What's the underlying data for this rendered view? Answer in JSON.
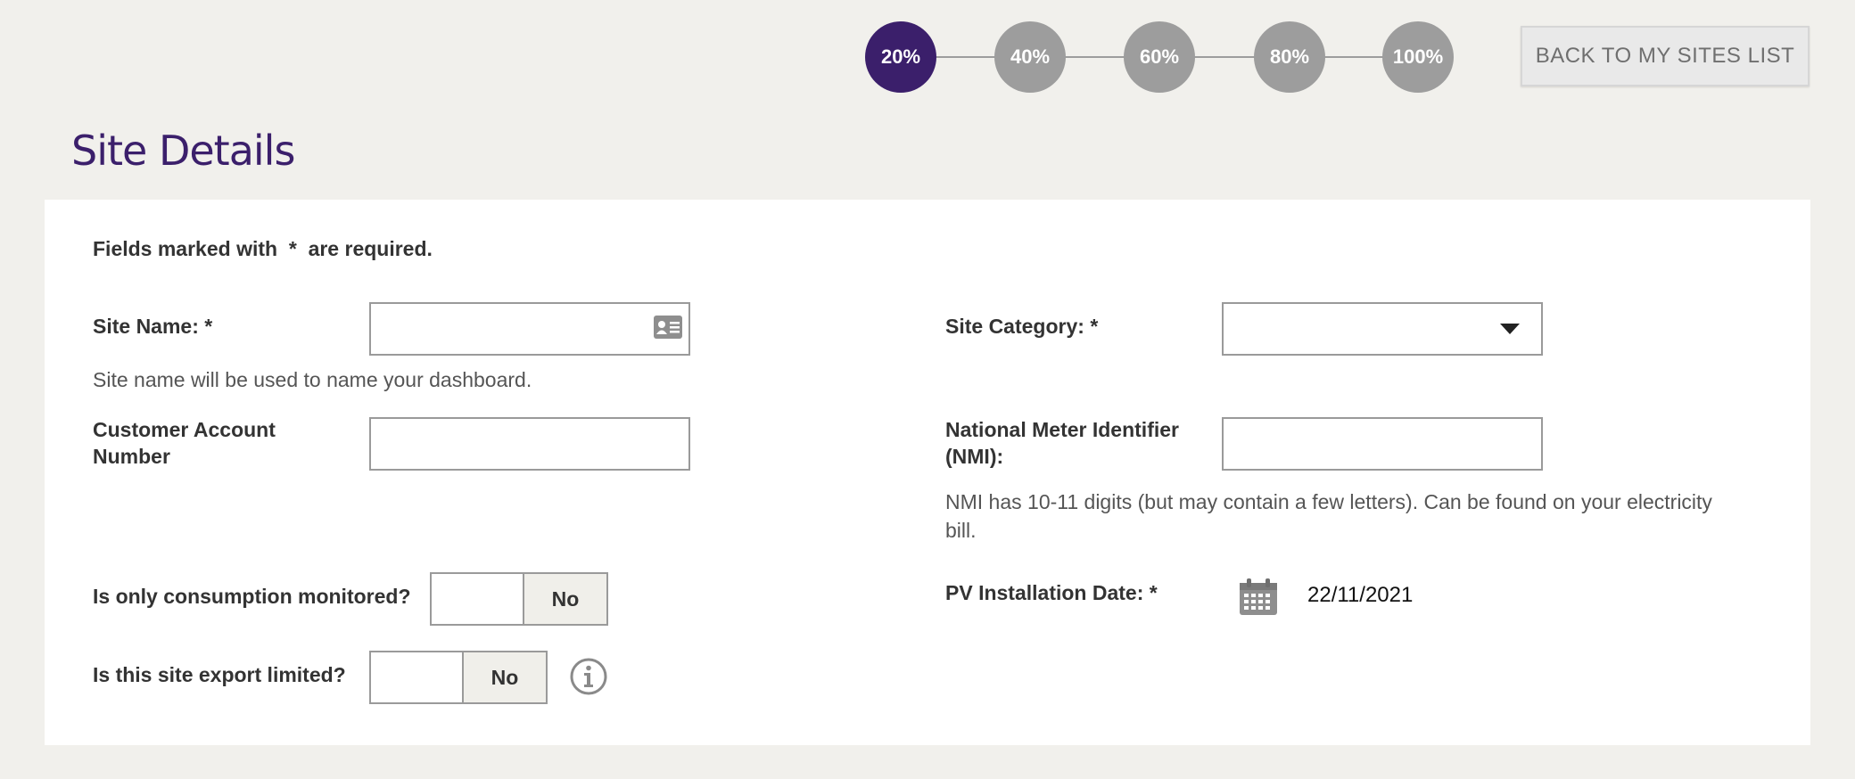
{
  "progress": {
    "steps": [
      "20%",
      "40%",
      "60%",
      "80%",
      "100%"
    ],
    "active_step": "20%"
  },
  "header": {
    "back_button_label": "BACK TO MY SITES LIST",
    "page_title": "Site Details"
  },
  "form": {
    "required_note": "Fields marked with  *  are required.",
    "site_name": {
      "label": "Site Name: *",
      "value": "",
      "hint": "Site name will be used to name your dashboard.",
      "icon": "contact-card-icon"
    },
    "site_category": {
      "label": "Site Category: *",
      "selected": ""
    },
    "customer_account": {
      "label_line1": "Customer Account",
      "label_line2": "Number",
      "value": ""
    },
    "nmi": {
      "label_line1": "National Meter Identifier",
      "label_line2": "(NMI):",
      "value": "",
      "hint": "NMI has 10-11 digits (but may contain a few letters). Can be found on your electricity bill."
    },
    "consumption_monitored": {
      "label": "Is only consumption monitored?",
      "value_label": "No"
    },
    "export_limited": {
      "label": "Is this site export limited?",
      "value_label": "No",
      "info_icon": "info-icon"
    },
    "pv_installation_date": {
      "label": "PV Installation Date: *",
      "value": "22/11/2021",
      "icon": "calendar-icon"
    }
  },
  "colors": {
    "accent": "#3b1f6b",
    "inactive_step": "#9d9d9d",
    "page_background": "#f1f0ec",
    "card_background": "#ffffff"
  }
}
